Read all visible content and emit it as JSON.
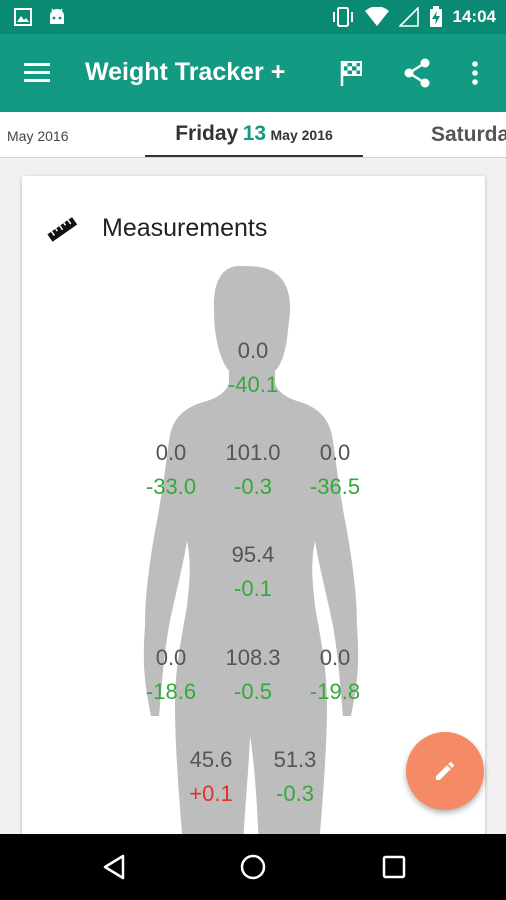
{
  "status_bar": {
    "time": "14:04",
    "icons": [
      "image-icon",
      "android-icon",
      "vibrate-icon",
      "wifi-icon",
      "signal-icon",
      "battery-charging-icon"
    ]
  },
  "app_bar": {
    "title": "Weight Tracker +",
    "actions": [
      "menu-icon",
      "flag-icon",
      "share-icon",
      "more-vert-icon"
    ]
  },
  "day_tabs": {
    "previous": "May 2016",
    "current": {
      "weekday": "Friday",
      "day": "13",
      "month": "May 2016"
    },
    "next": "Saturday"
  },
  "card": {
    "title": "Measurements",
    "icon": "ruler-icon",
    "measurements": {
      "neck": {
        "value": "0.0",
        "delta": "-40.1",
        "trend": "good"
      },
      "left_arm": {
        "value": "0.0",
        "delta": "-33.0",
        "trend": "good"
      },
      "chest": {
        "value": "101.0",
        "delta": "-0.3",
        "trend": "good"
      },
      "right_arm": {
        "value": "0.0",
        "delta": "-36.5",
        "trend": "good"
      },
      "waist": {
        "value": "95.4",
        "delta": "-0.1",
        "trend": "good"
      },
      "left_forearm": {
        "value": "0.0",
        "delta": "-18.6",
        "trend": "good"
      },
      "hips": {
        "value": "108.3",
        "delta": "-0.5",
        "trend": "good"
      },
      "right_forearm": {
        "value": "0.0",
        "delta": "-19.8",
        "trend": "good"
      },
      "left_thigh": {
        "value": "45.6",
        "delta": "+0.1",
        "trend": "bad"
      },
      "right_thigh": {
        "value": "51.3",
        "delta": "-0.3",
        "trend": "good"
      }
    }
  },
  "fab": {
    "icon": "edit-pencil-icon"
  },
  "nav_bar": {
    "buttons": [
      "back-icon",
      "home-icon",
      "recents-icon"
    ]
  },
  "colors": {
    "status_bar": "#0a8a72",
    "app_bar": "#129b82",
    "positive": "#35a83b",
    "negative": "#e2302c",
    "fab": "#f58a66",
    "silhouette": "#bdbdbd"
  }
}
